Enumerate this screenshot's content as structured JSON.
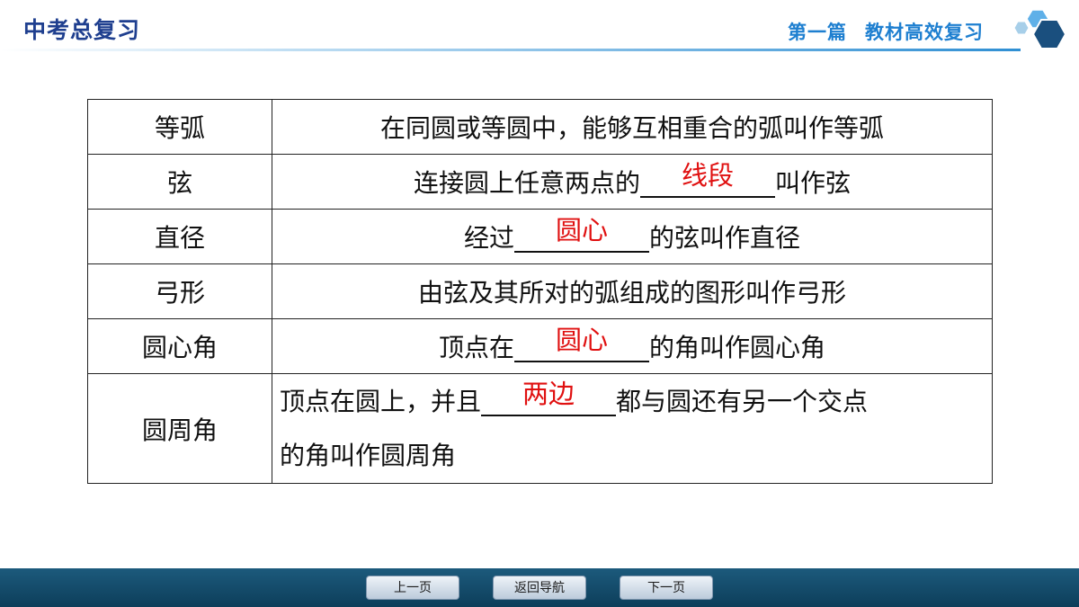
{
  "header": {
    "title": "中考总复习",
    "section_part": "第一篇",
    "section_name": "教材高效复习"
  },
  "colors": {
    "title": "#1f3f8f",
    "section": "#1e7fd0",
    "answer": "#e01010",
    "footer": "#0d3e5a"
  },
  "table": {
    "rows": [
      {
        "term": "等弧",
        "text": "在同圆或等圆中，能够互相重合的弧叫作等弧"
      },
      {
        "term": "弦",
        "before": "连接圆上任意两点的",
        "answer": "线段",
        "after": "叫作弦"
      },
      {
        "term": "直径",
        "before": "经过",
        "answer": "圆心",
        "after": "的弦叫作直径"
      },
      {
        "term": "弓形",
        "text": "由弦及其所对的弧组成的图形叫作弓形"
      },
      {
        "term": "圆心角",
        "before": "顶点在",
        "answer": "圆心",
        "after": "的角叫作圆心角"
      },
      {
        "term": "圆周角",
        "before": "顶点在圆上，并且",
        "answer": "两边",
        "after": "都与圆还有另一个交点",
        "line2": "的角叫作圆周角"
      }
    ]
  },
  "footer": {
    "prev_label": "上一页",
    "home_label": "返回导航",
    "next_label": "下一页"
  },
  "icons": [
    "hexagon-logo-icon"
  ]
}
